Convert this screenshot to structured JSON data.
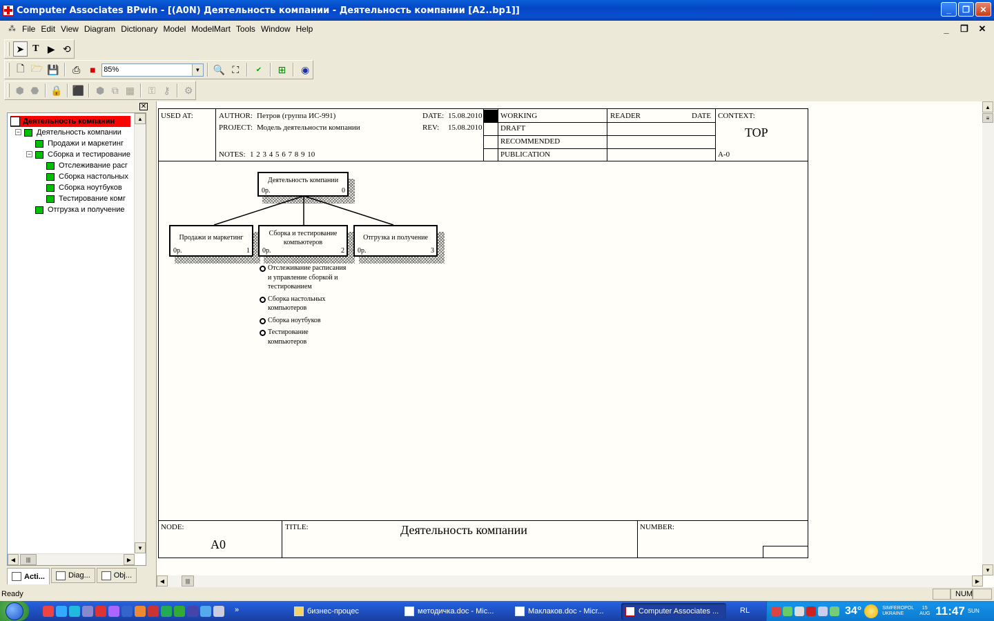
{
  "window": {
    "title": "Computer Associates BPwin - [(A0N) Деятельность компании - Деятельность компании  [A2..bp1]]"
  },
  "menu": [
    "File",
    "Edit",
    "View",
    "Diagram",
    "Dictionary",
    "Model",
    "ModelMart",
    "Tools",
    "Window",
    "Help"
  ],
  "toolbar": {
    "zoom_value": "85%"
  },
  "explorer": {
    "tree": [
      {
        "label": "Деятельность компании",
        "level": 0,
        "selected": true
      },
      {
        "label": "Деятельность компании",
        "level": 1
      },
      {
        "label": "Продажи и маркетинг",
        "level": 2
      },
      {
        "label": "Сборка и тестирование",
        "level": 2
      },
      {
        "label": "Отслеживание  расг",
        "level": 3
      },
      {
        "label": "Сборка настольных",
        "level": 3
      },
      {
        "label": "Сборка ноутбуков",
        "level": 3
      },
      {
        "label": "Тестирование  комг",
        "level": 3
      },
      {
        "label": "Отгрузка и получение",
        "level": 2
      }
    ],
    "tabs": [
      "Acti...",
      "Diag...",
      "Obj..."
    ]
  },
  "diagram": {
    "header": {
      "used_at_label": "USED AT:",
      "author_label": "AUTHOR:",
      "author_value": "Петров (группа ИС-991)",
      "project_label": "PROJECT:",
      "project_value": "Модель деятельности компании",
      "date_label": "DATE:",
      "date_value": "15.08.2010",
      "rev_label": "REV:",
      "rev_value": "15.08.2010",
      "notes_label": "NOTES:",
      "notes_value": "1  2  3  4  5  6  7  8  9  10",
      "status": [
        "WORKING",
        "DRAFT",
        "RECOMMENDED",
        "PUBLICATION"
      ],
      "reader_label": "READER",
      "reader_date_label": "DATE",
      "context_label": "CONTEXT:",
      "context_value": "TOP",
      "context_node": "A-0"
    },
    "boxes": [
      {
        "name": "Деятельность компании",
        "cost": "0р.",
        "number": "0"
      },
      {
        "name": "Продажи и маркетинг",
        "cost": "0р.",
        "number": "1"
      },
      {
        "name": "Сборка и тестирование компьютеров",
        "cost": "0р.",
        "number": "2"
      },
      {
        "name": "Отгрузка и получение",
        "cost": "0р.",
        "number": "3"
      }
    ],
    "sub_activities": [
      "Отслеживание расписания и управление  сборкой и тестированием",
      "Сборка настольных компьютеров",
      "Сборка ноутбуков",
      "Тестирование компьютеров"
    ],
    "footer": {
      "node_label": "NODE:",
      "node_value": "A0",
      "title_label": "TITLE:",
      "title_value": "Деятельность компании",
      "number_label": "NUMBER:"
    }
  },
  "statusbar": {
    "text": "Ready",
    "num": "NUM"
  },
  "taskbar": {
    "tasks": [
      {
        "label": "бизнес-процес",
        "active": false
      },
      {
        "label": "методичка.doc - Mic...",
        "active": false
      },
      {
        "label": "Маклаков.doc - Micr...",
        "active": false
      },
      {
        "label": "Computer Associates ...",
        "active": true
      }
    ],
    "lang": "RL",
    "temperature": "34°",
    "city": "SIMFEROPOL",
    "country": "UKRAINE",
    "date_day": "15",
    "date_month": "AUG",
    "time": "11:47",
    "weekday": "SUN"
  },
  "colors": {
    "title_blue": "#0a4fd0",
    "selected_red": "#ff0000",
    "node_green": "#00c000"
  }
}
